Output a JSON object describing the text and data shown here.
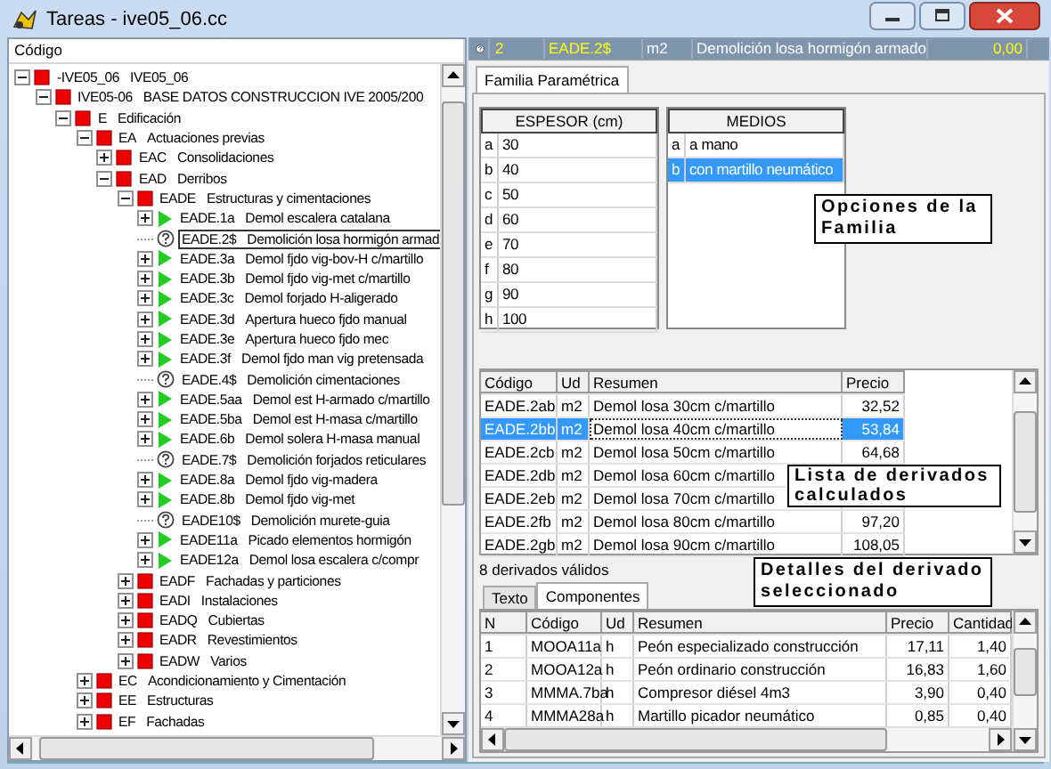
{
  "window": {
    "title": "Tareas - ive05_06.cc"
  },
  "tree": {
    "header": "Código",
    "items": [
      {
        "code": "-IVE05_06",
        "name": "IVE05_06",
        "kind": "folder",
        "expanded": true,
        "selected": false,
        "children": [
          {
            "code": "IVE05-06",
            "name": "BASE DATOS CONSTRUCCION IVE 2005/200",
            "kind": "folder",
            "expanded": true,
            "selected": false,
            "children": [
              {
                "code": "E",
                "name": "Edificación",
                "kind": "folder",
                "expanded": true,
                "selected": false,
                "children": [
                  {
                    "code": "EA",
                    "name": "Actuaciones previas",
                    "kind": "folder",
                    "expanded": true,
                    "selected": false,
                    "children": [
                      {
                        "code": "EAC",
                        "name": "Consolidaciones",
                        "kind": "folder",
                        "expanded": false,
                        "selected": false
                      },
                      {
                        "code": "EAD",
                        "name": "Derribos",
                        "kind": "folder",
                        "expanded": true,
                        "selected": false,
                        "children": [
                          {
                            "code": "EADE",
                            "name": "Estructuras y cimentaciones",
                            "kind": "folder",
                            "expanded": true,
                            "selected": false,
                            "children": [
                              {
                                "code": "EADE.1a",
                                "name": "Demol escalera catalana",
                                "kind": "task",
                                "expanded": false,
                                "selected": false
                              },
                              {
                                "code": "EADE.2$",
                                "name": "Demolición losa hormigón armad",
                                "kind": "family",
                                "selected": true
                              },
                              {
                                "code": "EADE.3a",
                                "name": "Demol fjdo vig-bov-H c/martillo",
                                "kind": "task",
                                "expanded": false,
                                "selected": false
                              },
                              {
                                "code": "EADE.3b",
                                "name": "Demol fjdo vig-met c/martillo",
                                "kind": "task",
                                "expanded": false,
                                "selected": false
                              },
                              {
                                "code": "EADE.3c",
                                "name": "Demol forjado H-aligerado",
                                "kind": "task",
                                "expanded": false,
                                "selected": false
                              },
                              {
                                "code": "EADE.3d",
                                "name": "Apertura hueco fjdo manual",
                                "kind": "task",
                                "expanded": false,
                                "selected": false
                              },
                              {
                                "code": "EADE.3e",
                                "name": "Apertura hueco fjdo mec",
                                "kind": "task",
                                "expanded": false,
                                "selected": false
                              },
                              {
                                "code": "EADE.3f",
                                "name": "Demol fjdo man vig pretensada",
                                "kind": "task",
                                "expanded": false,
                                "selected": false
                              },
                              {
                                "code": "EADE.4$",
                                "name": "Demolición cimentaciones",
                                "kind": "family",
                                "selected": false
                              },
                              {
                                "code": "EADE.5aa",
                                "name": "Demol est H-armado c/martillo",
                                "kind": "task",
                                "expanded": false,
                                "selected": false
                              },
                              {
                                "code": "EADE.5ba",
                                "name": "Demol est H-masa c/martillo",
                                "kind": "task",
                                "expanded": false,
                                "selected": false
                              },
                              {
                                "code": "EADE.6b",
                                "name": "Demol solera H-masa manual",
                                "kind": "task",
                                "expanded": false,
                                "selected": false
                              },
                              {
                                "code": "EADE.7$",
                                "name": "Demolición forjados reticulares",
                                "kind": "family",
                                "selected": false
                              },
                              {
                                "code": "EADE.8a",
                                "name": "Demol fjdo vig-madera",
                                "kind": "task",
                                "expanded": false,
                                "selected": false
                              },
                              {
                                "code": "EADE.8b",
                                "name": "Demol fjdo vig-met",
                                "kind": "task",
                                "expanded": false,
                                "selected": false
                              },
                              {
                                "code": "EADE10$",
                                "name": "Demolición murete-guia",
                                "kind": "family",
                                "selected": false
                              },
                              {
                                "code": "EADE11a",
                                "name": "Picado elementos hormigón",
                                "kind": "task",
                                "expanded": false,
                                "selected": false
                              },
                              {
                                "code": "EADE12a",
                                "name": "Demol losa escalera c/compr",
                                "kind": "task",
                                "expanded": false,
                                "selected": false
                              }
                            ]
                          },
                          {
                            "code": "EADF",
                            "name": "Fachadas y particiones",
                            "kind": "folder",
                            "expanded": false,
                            "selected": false
                          },
                          {
                            "code": "EADI",
                            "name": "Instalaciones",
                            "kind": "folder",
                            "expanded": false,
                            "selected": false
                          },
                          {
                            "code": "EADQ",
                            "name": "Cubiertas",
                            "kind": "folder",
                            "expanded": false,
                            "selected": false
                          },
                          {
                            "code": "EADR",
                            "name": "Revestimientos",
                            "kind": "folder",
                            "expanded": false,
                            "selected": false
                          },
                          {
                            "code": "EADW",
                            "name": "Varios",
                            "kind": "folder",
                            "expanded": false,
                            "selected": false
                          }
                        ]
                      }
                    ]
                  },
                  {
                    "code": "EC",
                    "name": "Acondicionamiento y Cimentación",
                    "kind": "folder",
                    "expanded": false,
                    "selected": false
                  },
                  {
                    "code": "EE",
                    "name": "Estructuras",
                    "kind": "folder",
                    "expanded": false,
                    "selected": false
                  },
                  {
                    "code": "EF",
                    "name": "Fachadas",
                    "kind": "folder",
                    "expanded": false,
                    "selected": false
                  }
                ]
              }
            ]
          }
        ]
      }
    ]
  },
  "info_bar": {
    "number": "2",
    "code": "EADE.2$",
    "unit": "m2",
    "summary": "Demolición losa hormigón armado",
    "price": "0,00"
  },
  "tabs": [
    {
      "label": "Familia Paramétrica",
      "selected": true
    }
  ],
  "parameters": [
    {
      "title": "ESPESOR (cm)",
      "options": [
        {
          "key": "a",
          "value": "30",
          "selected": false
        },
        {
          "key": "b",
          "value": "40",
          "selected": false
        },
        {
          "key": "c",
          "value": "50",
          "selected": false
        },
        {
          "key": "d",
          "value": "60",
          "selected": false
        },
        {
          "key": "e",
          "value": "70",
          "selected": false
        },
        {
          "key": "f",
          "value": "80",
          "selected": false
        },
        {
          "key": "g",
          "value": "90",
          "selected": false
        },
        {
          "key": "h",
          "value": "100",
          "selected": false
        }
      ]
    },
    {
      "title": "MEDIOS",
      "options": [
        {
          "key": "a",
          "value": "a mano",
          "selected": false
        },
        {
          "key": "b",
          "value": "con martillo neumático",
          "selected": true
        }
      ]
    }
  ],
  "derived": {
    "columns": [
      "Código",
      "Ud",
      "Resumen",
      "Precio"
    ],
    "rows": [
      {
        "code": "EADE.2ab",
        "unit": "m2",
        "summary": "Demol losa 30cm c/martillo",
        "price": "32,52",
        "selected": false
      },
      {
        "code": "EADE.2bb",
        "unit": "m2",
        "summary": "Demol losa 40cm c/martillo",
        "price": "53,84",
        "selected": true
      },
      {
        "code": "EADE.2cb",
        "unit": "m2",
        "summary": "Demol losa 50cm c/martillo",
        "price": "64,68",
        "selected": false
      },
      {
        "code": "EADE.2db",
        "unit": "m2",
        "summary": "Demol losa 60cm c/martillo",
        "selected": false
      },
      {
        "code": "EADE.2eb",
        "unit": "m2",
        "summary": "Demol losa 70cm c/martillo",
        "selected": false
      },
      {
        "code": "EADE.2fb",
        "unit": "m2",
        "summary": "Demol losa 80cm c/martillo",
        "price": "97,20",
        "selected": false
      },
      {
        "code": "EADE.2gb",
        "unit": "m2",
        "summary": "Demol losa 90cm c/martillo",
        "price": "108,05",
        "selected": false
      }
    ],
    "count": "8 derivados válidos"
  },
  "detail_tabs": [
    {
      "label": "Texto",
      "selected": false
    },
    {
      "label": "Componentes",
      "selected": true
    }
  ],
  "components": {
    "columns": [
      "N",
      "Código",
      "Ud",
      "Resumen",
      "Precio",
      "Cantidad"
    ],
    "rows": [
      {
        "n": "1",
        "code": "MOOA11a",
        "unit": "h",
        "summary": "Peón especializado construcción",
        "price": "17,11",
        "quantity": "1,40"
      },
      {
        "n": "2",
        "code": "MOOA12a",
        "unit": "h",
        "summary": "Peón ordinario construcción",
        "price": "16,83",
        "quantity": "1,60"
      },
      {
        "n": "3",
        "code": "MMMA.7ba",
        "unit": "h",
        "summary": "Compresor  diésel 4m3",
        "price": "3,90",
        "quantity": "0,40"
      },
      {
        "n": "4",
        "code": "MMMA28a",
        "unit": "h",
        "summary": "Martillo picador neumático",
        "price": "0,85",
        "quantity": "0,40"
      }
    ]
  },
  "callouts": [
    "Opciones de la Familia",
    "Lista de derivados calculados",
    "Detalles del derivado seleccionado"
  ]
}
